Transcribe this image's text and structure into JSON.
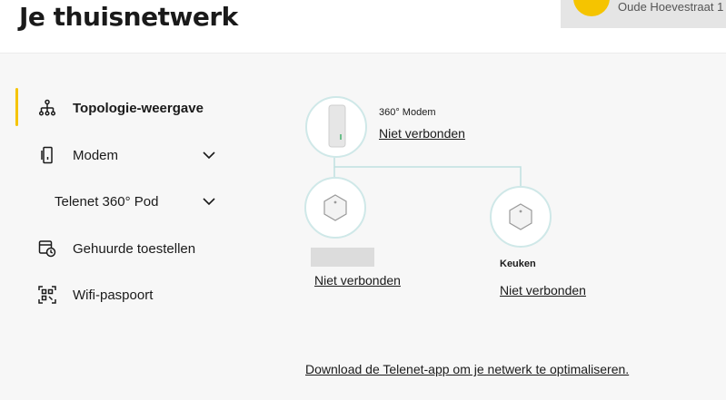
{
  "header": {
    "title": "Je thuisnetwerk",
    "address": "Oude Hoevestraat 1"
  },
  "sidebar": {
    "items": [
      {
        "label": "Topologie-weergave",
        "icon": "topology-icon",
        "active": true
      },
      {
        "label": "Modem",
        "icon": "modem-icon",
        "expandable": true
      },
      {
        "label": "Telenet 360° Pod",
        "expandable": true
      },
      {
        "label": "Gehuurde toestellen",
        "icon": "rented-devices-icon"
      },
      {
        "label": "Wifi-paspoort",
        "icon": "qr-code-icon"
      }
    ]
  },
  "topology": {
    "modem": {
      "name": "360° Modem",
      "status": "Niet verbonden"
    },
    "pods": [
      {
        "name": "",
        "status": "Niet verbonden"
      },
      {
        "name": "Keuken",
        "status": "Niet verbonden"
      }
    ]
  },
  "footer": {
    "link": "Download de Telenet-app om je netwerk te optimaliseren."
  },
  "colors": {
    "accent": "#f5c400",
    "connector": "#bfe0e0",
    "background": "#f7f7f7"
  }
}
